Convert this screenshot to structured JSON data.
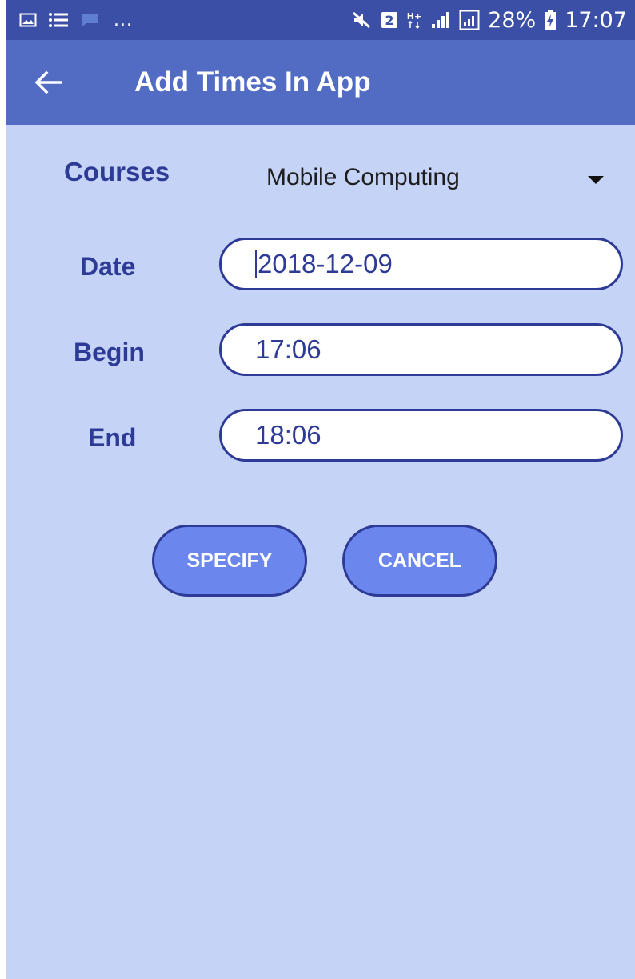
{
  "status_bar": {
    "icons_left": [
      "image-icon",
      "list-icon",
      "message-icon"
    ],
    "overflow": "...",
    "icons_right": [
      "mute-icon",
      "sim-2-icon",
      "hplus-icon",
      "signal-icon",
      "signal-2-icon"
    ],
    "battery": "28%",
    "time": "17:07"
  },
  "app_bar": {
    "title": "Add Times In App",
    "back_icon": "arrow-left-icon"
  },
  "form": {
    "courses_label": "Courses",
    "course_selected": "Mobile Computing",
    "date_label": "Date",
    "date_value": "2018-12-09",
    "begin_label": "Begin",
    "begin_value": "17:06",
    "end_label": "End",
    "end_value": "18:06"
  },
  "buttons": {
    "specify": "SPECIFY",
    "cancel": "CANCEL"
  },
  "colors": {
    "status_bar": "#3b4fa6",
    "app_bar": "#526bc3",
    "background": "#c5d3f6",
    "accent_text": "#2d3b96",
    "button_fill": "#6b87ee"
  }
}
